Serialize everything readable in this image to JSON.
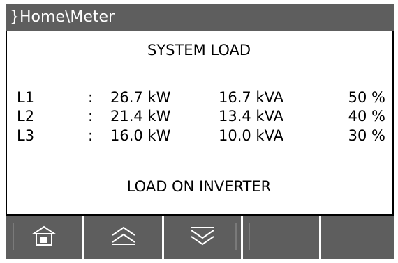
{
  "titlebar": {
    "path": "}Home\\Meter"
  },
  "main": {
    "heading": "SYSTEM LOAD",
    "rows": [
      {
        "line": "L1",
        "colon": ":",
        "kw": "26.7 kW",
        "kva": "16.7 kVA",
        "pct": "50 %"
      },
      {
        "line": "L2",
        "colon": ":",
        "kw": "21.4 kW",
        "kva": "13.4 kVA",
        "pct": "40 %"
      },
      {
        "line": "L3",
        "colon": ":",
        "kw": "16.0 kW",
        "kva": "10.0 kVA",
        "pct": "30 %"
      }
    ],
    "status": "LOAD ON INVERTER"
  },
  "softkeys": [
    {
      "icon": "home-icon"
    },
    {
      "icon": "double-chevron-up-icon"
    },
    {
      "icon": "double-chevron-down-icon"
    },
    {
      "icon": ""
    },
    {
      "icon": ""
    }
  ],
  "colors": {
    "titlebar": "#5e5e5e",
    "softkey_bar": "#5e5e5e",
    "text": "#000000",
    "background": "#ffffff"
  }
}
